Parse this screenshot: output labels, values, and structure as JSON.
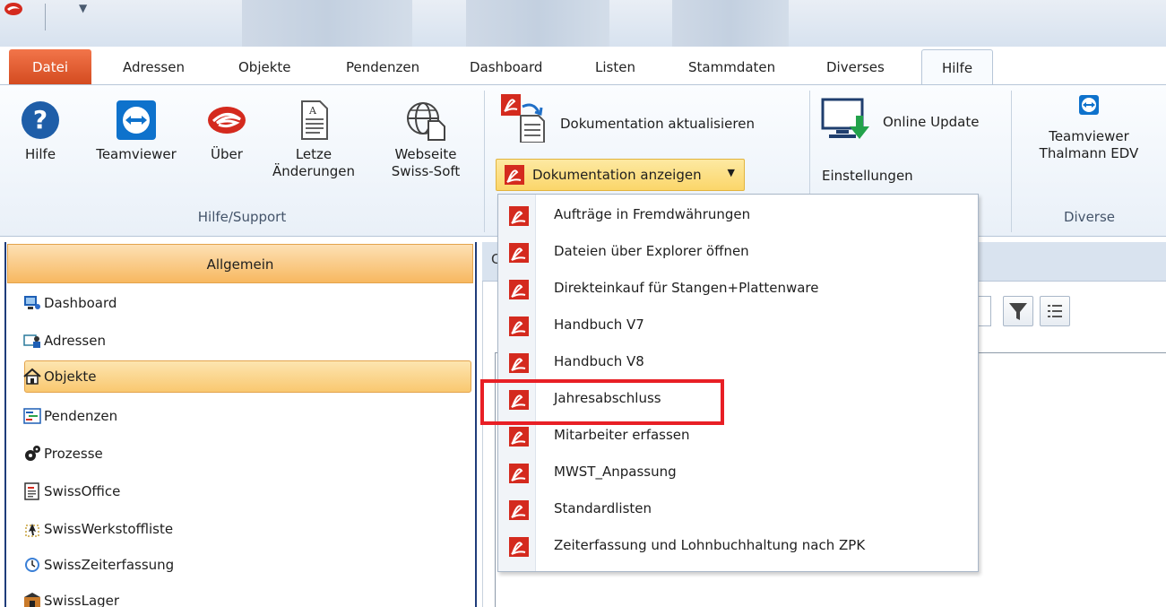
{
  "tabs": {
    "datei": "Datei",
    "adressen": "Adressen",
    "objekte": "Objekte",
    "pendenzen": "Pendenzen",
    "dashboard": "Dashboard",
    "listen": "Listen",
    "stammdaten": "Stammdaten",
    "diverses": "Diverses",
    "hilfe": "Hilfe"
  },
  "ribbon": {
    "hilfe": "Hilfe",
    "teamviewer": "Teamviewer",
    "ueber": "Über",
    "letzte_line1": "Letze",
    "letzte_line2": "Änderungen",
    "webseite_line1": "Webseite",
    "webseite_line2": "Swiss-Soft",
    "group_hilfe_support": "Hilfe/Support",
    "doku_aktualisieren": "Dokumentation aktualisieren",
    "doku_anzeigen": "Dokumentation anzeigen",
    "online_update": "Online Update",
    "einstellungen": "Einstellungen",
    "teamviewer_tm_line1": "Teamviewer",
    "teamviewer_tm_line2": "Thalmann EDV",
    "group_diverse": "Diverse"
  },
  "left_panel": {
    "header": "Allgemein",
    "items": [
      "Dashboard",
      "Adressen",
      "Objekte",
      "Pendenzen",
      "Prozesse",
      "SwissOffice",
      "SwissWerkstoffliste",
      "SwissZeiterfassung",
      "SwissLager"
    ],
    "selected": "Objekte"
  },
  "right_panel": {
    "header_partial": "C"
  },
  "dropdown": {
    "items": [
      "Aufträge in Fremdwährungen",
      "Dateien über Explorer öffnen",
      "Direkteinkauf für Stangen+Plattenware",
      "Handbuch V7",
      "Handbuch V8",
      "Jahresabschluss",
      "Mitarbeiter erfassen",
      "MWST_Anpassung",
      "Standardlisten",
      "Zeiterfassung und Lohnbuchhaltung nach ZPK"
    ],
    "highlighted": "Jahresabschluss"
  },
  "colors": {
    "accent_orange": "#f7b860",
    "datei_tab": "#d34a1f",
    "pdf_red": "#d42a1e",
    "highlight_red": "#e81f25",
    "panel_border": "#1f3c7a"
  },
  "icons": {
    "hilfe": "question-circle-icon",
    "teamviewer": "teamviewer-icon",
    "ueber": "swirl-logo-icon",
    "letzte": "document-icon",
    "webseite": "globe-document-icon",
    "pdf": "pdf-icon",
    "online_update": "monitor-download-icon",
    "filter": "filter-icon",
    "list": "list-icon"
  }
}
